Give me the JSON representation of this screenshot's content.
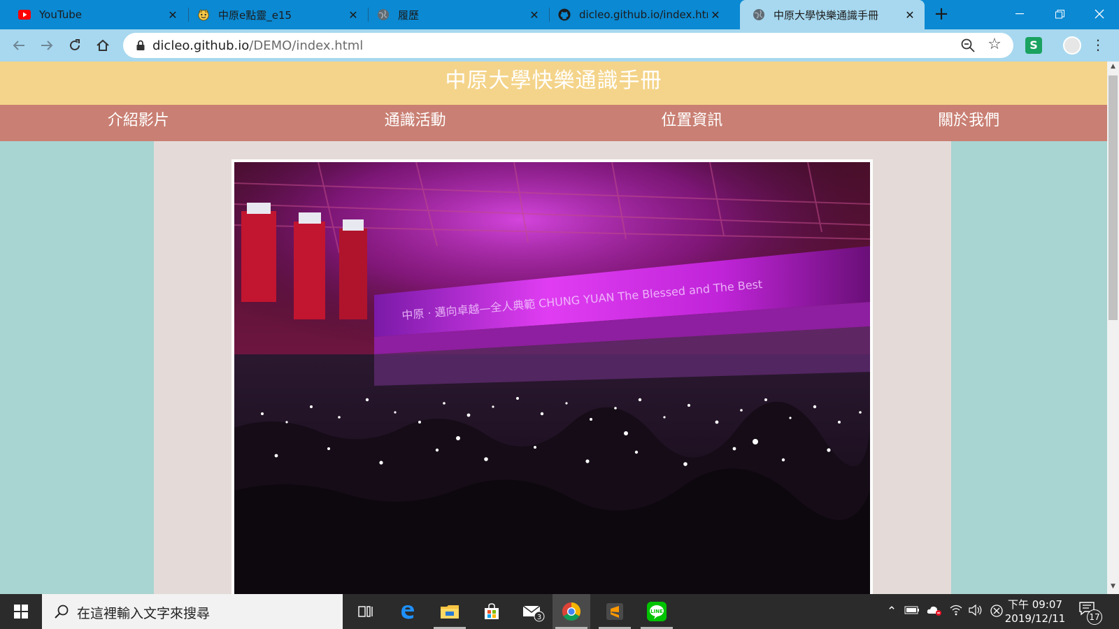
{
  "browser": {
    "tabs": [
      {
        "title": "YouTube",
        "favicon": "youtube-icon",
        "active": false
      },
      {
        "title": "中原e點靈_e15",
        "favicon": "emoji-face-icon",
        "active": false
      },
      {
        "title": "履歷",
        "favicon": "globe-icon",
        "active": false
      },
      {
        "title": "dicleo.github.io/index.htm",
        "favicon": "github-icon",
        "active": false
      },
      {
        "title": "中原大學快樂通識手冊",
        "favicon": "globe-icon",
        "active": true
      }
    ],
    "close_glyph": "✕",
    "new_tab_glyph": "+",
    "url": {
      "host": "dicleo.github.io",
      "path": "/DEMO/index.html"
    },
    "accent": "#0b89d3",
    "toolbar_color": "#a7d8ef"
  },
  "page": {
    "site_title": "中原大學快樂通識手冊",
    "nav": [
      {
        "label": "介紹影片"
      },
      {
        "label": "通識活動"
      },
      {
        "label": "位置資訊"
      },
      {
        "label": "關於我們"
      }
    ],
    "banner_text": "中原 · 邁向卓越—全人典範 CHUNG YUAN The Blessed and The Best",
    "colors": {
      "header": "#f4d48a",
      "nav": "#c97f73",
      "background": "#a8d4d1",
      "content": "#e4dbd9"
    }
  },
  "taskbar": {
    "search_placeholder": "在這裡輸入文字來搜尋",
    "mail_badge": "3",
    "clock_time": "下午 09:07",
    "clock_date": "2019/12/11",
    "notification_count": "17"
  }
}
